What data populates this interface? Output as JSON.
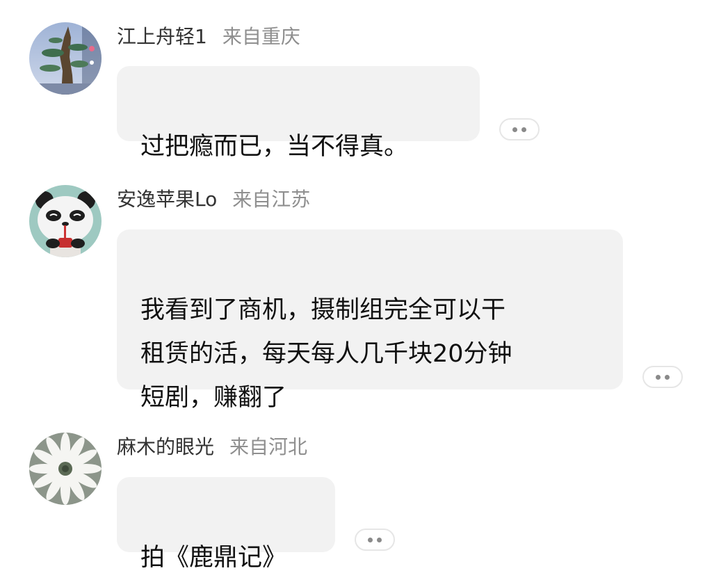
{
  "comments": [
    {
      "username": "江上舟轻1",
      "location": "来自重庆",
      "text": "过把瘾而已，当不得真。",
      "avatar": "tree-avatar",
      "more_icon": "more-dots-icon"
    },
    {
      "username": "安逸苹果Lo",
      "location": "来自江苏",
      "text": "我看到了商机，摄制组完全可以干\n租赁的活，每天每人几千块20分钟\n短剧，赚翻了",
      "avatar": "panda-avatar",
      "more_icon": "more-dots-icon"
    },
    {
      "username": "麻木的眼光",
      "location": "来自河北",
      "text": "拍《鹿鼎记》",
      "avatar": "flower-avatar",
      "more_icon": "more-dots-icon"
    }
  ],
  "colors": {
    "bubble_background": "#f2f2f2",
    "username": "#333333",
    "location": "#8f8f8f",
    "text": "#111111"
  }
}
